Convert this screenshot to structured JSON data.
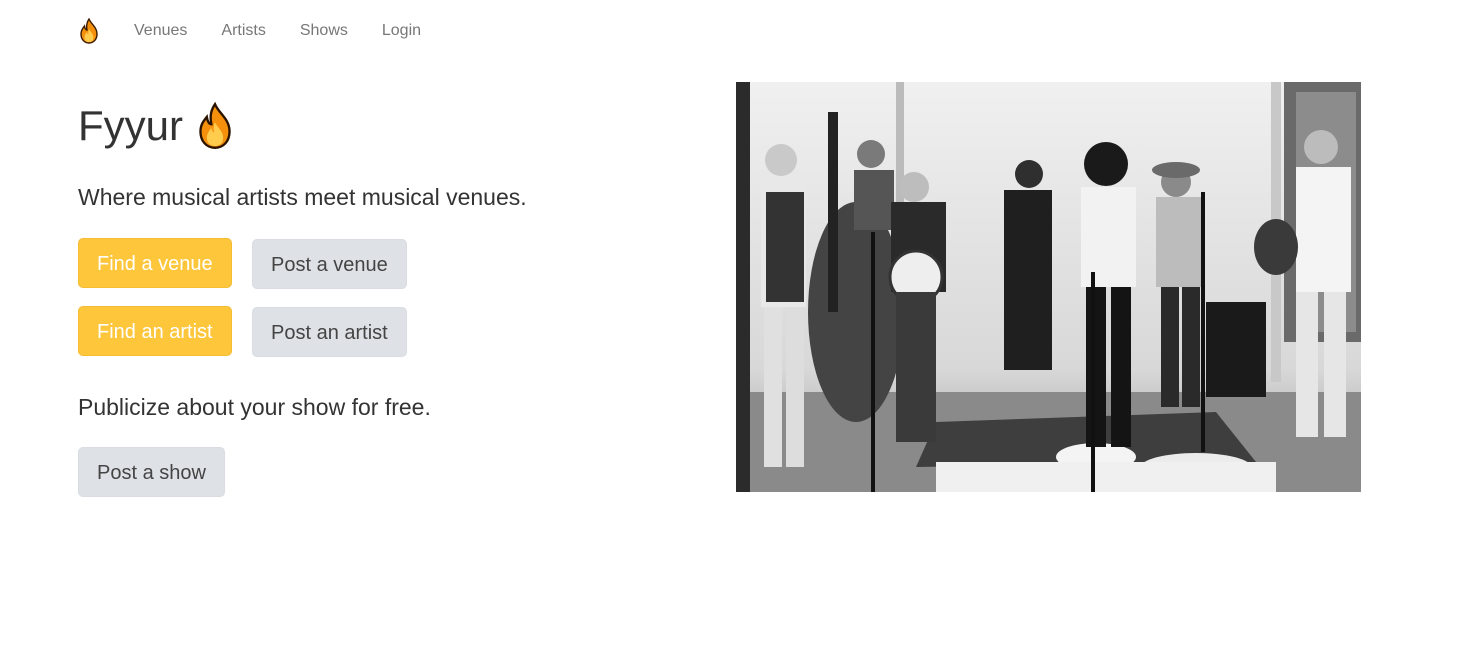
{
  "nav": {
    "brand_icon": "flame-icon",
    "items": [
      {
        "label": "Venues"
      },
      {
        "label": "Artists"
      },
      {
        "label": "Shows"
      },
      {
        "label": "Login"
      }
    ]
  },
  "hero": {
    "title": "Fyyur",
    "title_icon": "flame-icon",
    "tagline": "Where musical artists meet musical venues.",
    "buttons": {
      "find_venue": "Find a venue",
      "post_venue": "Post a venue",
      "find_artist": "Find an artist",
      "post_artist": "Post an artist",
      "post_show": "Post a show"
    },
    "publicize": "Publicize about your show for free."
  },
  "image": {
    "description": "black-and-white photo of a bluegrass band performing"
  },
  "colors": {
    "warning": "#fec63a",
    "light": "#dee2e6",
    "text": "#333333",
    "nav_text": "#777777"
  }
}
